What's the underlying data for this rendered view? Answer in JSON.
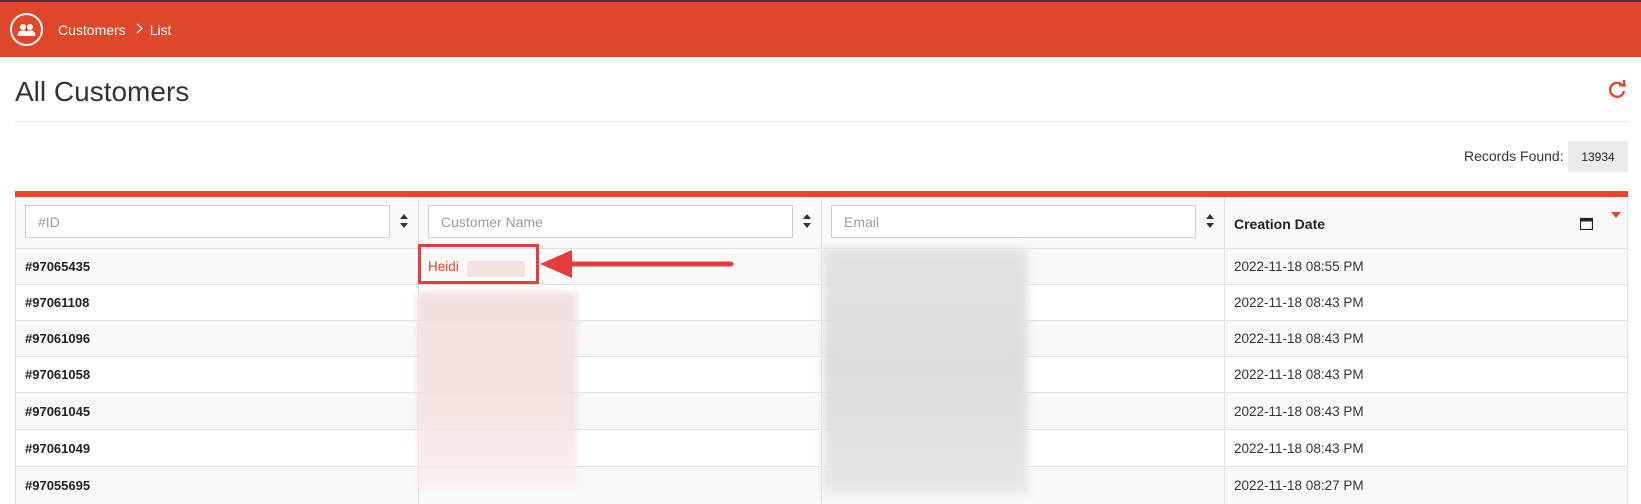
{
  "header": {
    "breadcrumb": [
      "Customers",
      "List"
    ],
    "icon": "users-icon",
    "color": "#de4828"
  },
  "page": {
    "title": "All Customers",
    "refresh_icon": "refresh-icon"
  },
  "records": {
    "label": "Records Found:",
    "count": "13934"
  },
  "table": {
    "filters": {
      "id_placeholder": "#ID",
      "name_placeholder": "Customer Name",
      "email_placeholder": "Email"
    },
    "date_header": "Creation Date",
    "rows": [
      {
        "id": "#97065435",
        "name": "Heidi",
        "date": "2022-11-18 08:55 PM"
      },
      {
        "id": "#97061108",
        "name": "",
        "date": "2022-11-18 08:43 PM"
      },
      {
        "id": "#97061096",
        "name": "",
        "date": "2022-11-18 08:43 PM"
      },
      {
        "id": "#97061058",
        "name": "",
        "date": "2022-11-18 08:43 PM"
      },
      {
        "id": "#97061045",
        "name": "",
        "date": "2022-11-18 08:43 PM"
      },
      {
        "id": "#97061049",
        "name": "",
        "date": "2022-11-18 08:43 PM"
      },
      {
        "id": "#97055695",
        "name": "",
        "date": "2022-11-18 08:27 PM"
      }
    ]
  },
  "colors": {
    "accent": "#de4828",
    "highlight": "#e53d3d",
    "link": "#d84a2e"
  }
}
